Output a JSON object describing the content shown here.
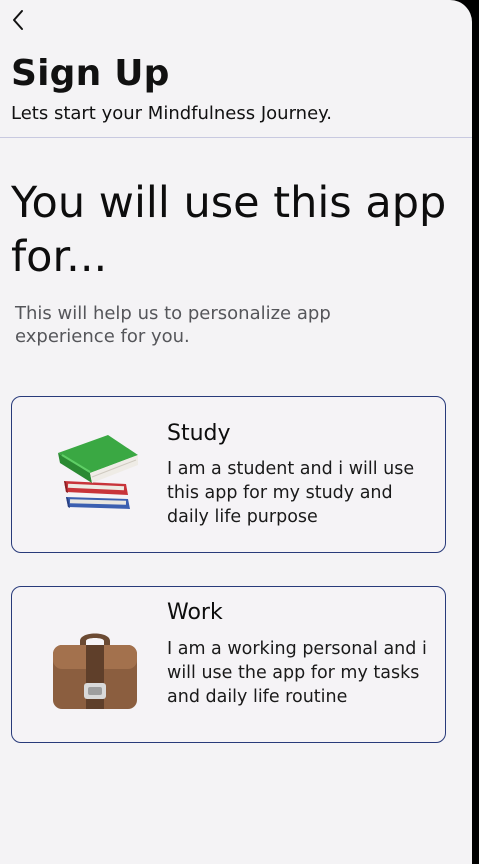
{
  "header": {
    "back_icon": "chevron-left-icon",
    "title": "Sign Up",
    "subtitle": "Lets start your Mindfulness Journey."
  },
  "main": {
    "heading": "You will use this app for...",
    "description": "This will help us to personalize app experience for you.",
    "options": [
      {
        "title": "Study",
        "text": "I am a student and i will use this app for my study and daily life purpose",
        "icon": "books-icon"
      },
      {
        "title": "Work",
        "text": "I am a working personal and i will use the app for my tasks and daily life routine",
        "icon": "briefcase-icon"
      }
    ]
  },
  "colors": {
    "background": "#f4f3f5",
    "card_border": "#283a7a",
    "divider": "#c8c9e0"
  }
}
